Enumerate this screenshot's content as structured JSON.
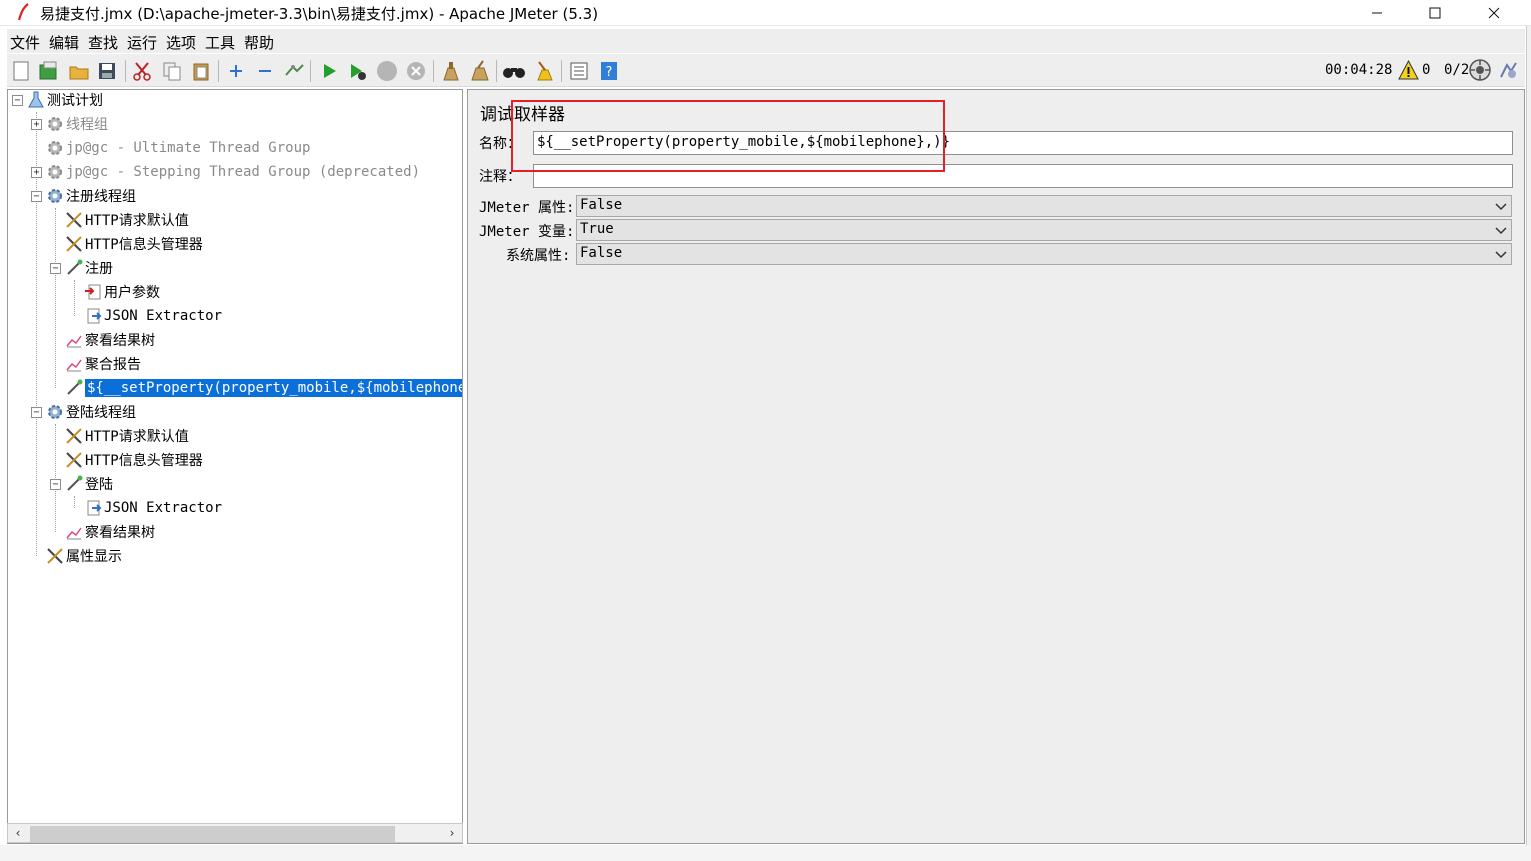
{
  "window": {
    "title": "易捷支付.jmx (D:\\apache-jmeter-3.3\\bin\\易捷支付.jmx) - Apache JMeter (5.3)"
  },
  "menu": [
    "文件",
    "编辑",
    "查找",
    "运行",
    "选项",
    "工具",
    "帮助"
  ],
  "toolbar": {
    "timer": "00:04:28",
    "warning_count": "0",
    "threads": "0/2"
  },
  "tree": {
    "root": "测试计划",
    "thread_group": "线程组",
    "ultimate_group": "jp@gc - Ultimate Thread Group",
    "stepping_group": "jp@gc - Stepping Thread Group (deprecated)",
    "register_group": "注册线程组",
    "http_defaults_1": "HTTP请求默认值",
    "http_header_1": "HTTP信息头管理器",
    "register_sampler": "注册",
    "user_params": "用户参数",
    "json_extractor_1": "JSON Extractor",
    "result_tree_1": "察看结果树",
    "aggregate_report": "聚合报告",
    "debug_sampler": "${__setProperty(property_mobile,${mobilephone},",
    "login_group": "登陆线程组",
    "http_defaults_2": "HTTP请求默认值",
    "http_header_2": "HTTP信息头管理器",
    "login_sampler": "登陆",
    "json_extractor_2": "JSON Extractor",
    "result_tree_2": "察看结果树",
    "property_display": "属性显示"
  },
  "panel": {
    "title": "调试取样器",
    "name_label": "名称：",
    "name_value": "${__setProperty(property_mobile,${mobilephone},)}",
    "comment_label": "注释：",
    "comment_value": "",
    "jmeter_props_label": "JMeter 属性:",
    "jmeter_props_value": "False",
    "jmeter_vars_label": "JMeter 变量:",
    "jmeter_vars_value": "True",
    "system_props_label": "系统属性:",
    "system_props_value": "False"
  },
  "colors": {
    "selection": "#0a6fd8",
    "highlight_box": "#e0212a",
    "panel_bg": "#eeeeee"
  }
}
